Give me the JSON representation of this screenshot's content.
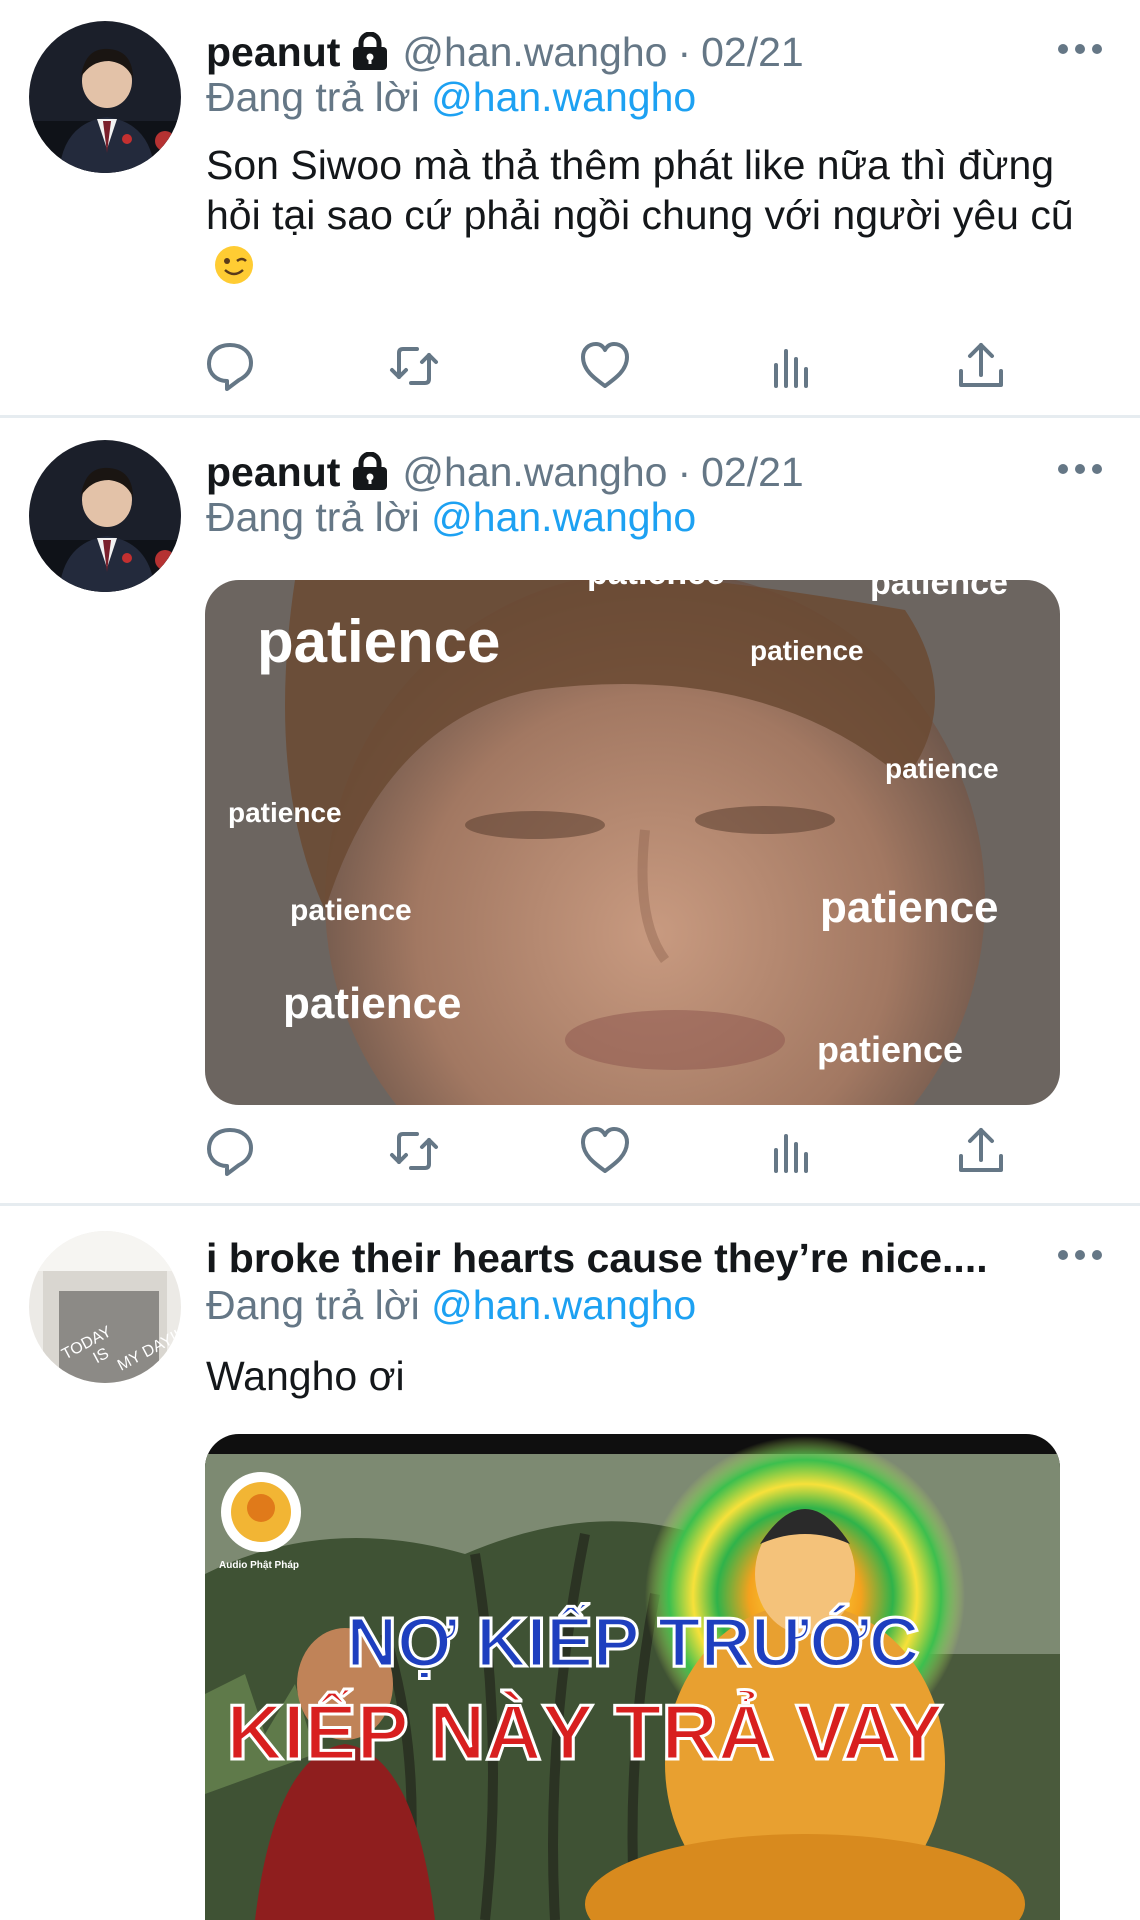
{
  "tweets": [
    {
      "display_name": "peanut",
      "handle": "@han.wangho",
      "separator": "·",
      "date": "02/21",
      "reply_prefix": "Đang trả lời",
      "reply_to": "@han.wangho",
      "text": "Son Siwoo mà thả thêm phát like nữa thì đừng hỏi tại sao cứ phải ngồi chung với người yêu cũ",
      "emoji": "winking-face"
    },
    {
      "display_name": "peanut",
      "handle": "@han.wangho",
      "separator": "·",
      "date": "02/21",
      "reply_prefix": "Đang trả lời",
      "reply_to": "@han.wangho",
      "media": {
        "words": [
          "patience",
          "patience",
          "patience",
          "patience",
          "patience",
          "patience",
          "patience",
          "patience",
          "patience",
          "patience"
        ]
      }
    },
    {
      "display_name": "i broke their hearts cause they’re nice....",
      "reply_prefix": "Đang trả lời",
      "reply_to": "@han.wangho",
      "text": "Wangho ơi",
      "avatar_text": [
        "TODAY",
        "IS",
        "MY DAY!!"
      ],
      "media": {
        "logo_text": "Audio Phật Pháp",
        "line1": "NỢ KIẾP TRƯỚC",
        "line2": "KIẾP NÀY TRẢ VAY"
      }
    }
  ],
  "action_icons": [
    "reply-icon",
    "retweet-icon",
    "like-icon",
    "analytics-icon",
    "share-icon"
  ],
  "colors": {
    "link": "#1da1f2",
    "secondary_text": "#657786",
    "divider": "#e6ecf0",
    "icon": "#657786"
  }
}
